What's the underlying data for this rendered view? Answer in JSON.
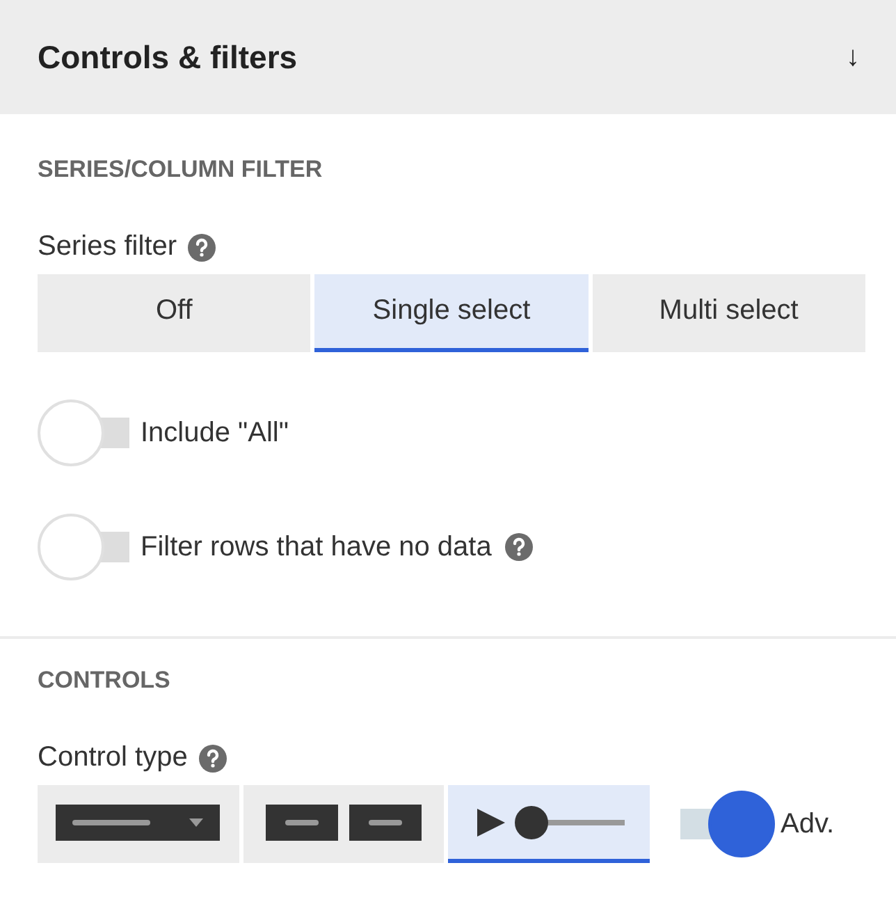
{
  "panel": {
    "title": "Controls & filters",
    "collapse_icon": "↓"
  },
  "sections": [
    {
      "heading": "SERIES/COLUMN FILTER",
      "field": {
        "label": "Series filter",
        "help": true,
        "options": [
          {
            "label": "Off",
            "selected": false
          },
          {
            "label": "Single select",
            "selected": true
          },
          {
            "label": "Multi select",
            "selected": false
          }
        ]
      },
      "toggles": [
        {
          "label": "Include \"All\"",
          "on": false,
          "help": false
        },
        {
          "label": "Filter rows that have no data",
          "on": false,
          "help": true
        }
      ]
    },
    {
      "heading": "CONTROLS",
      "field": {
        "label": "Control type",
        "help": true,
        "options": [
          {
            "kind": "dropdown",
            "selected": false
          },
          {
            "kind": "buttons",
            "selected": false
          },
          {
            "kind": "slider",
            "selected": true
          }
        ]
      },
      "advanced": {
        "label": "Adv.",
        "on": true
      }
    }
  ]
}
